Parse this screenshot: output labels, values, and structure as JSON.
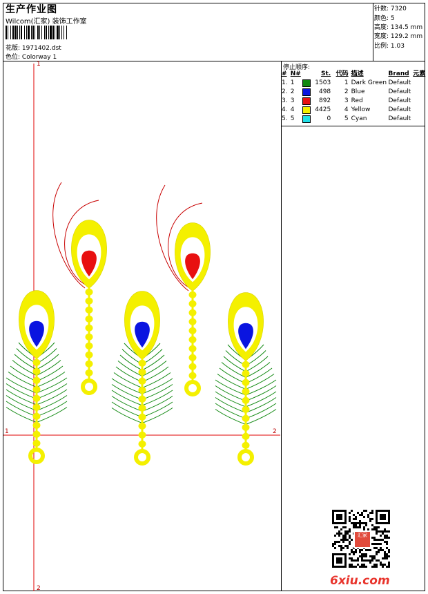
{
  "header": {
    "title": "生产作业图",
    "subtitle": "Wilcom(汇家) 装饰工作室",
    "design_label": "花版:",
    "design_value": "1971402.dst",
    "colorway_label": "色位:",
    "colorway_value": "Colorway 1"
  },
  "stats": [
    {
      "label": "针数:",
      "value": "7320"
    },
    {
      "label": "颜色:",
      "value": "5"
    },
    {
      "label": "高度:",
      "value": "134.5 mm"
    },
    {
      "label": "宽度:",
      "value": "129.2 mm"
    },
    {
      "label": "比例:",
      "value": "1.03"
    }
  ],
  "stop_sequence": {
    "title": "停止顺序:",
    "headers": [
      "#",
      "N#",
      "St.",
      "代码",
      "描述",
      "Brand",
      "元素"
    ],
    "rows": [
      {
        "num": "1.",
        "n": "1",
        "color": "#108810",
        "st": "1503",
        "code": "1",
        "desc": "Dark Green",
        "brand": "Default"
      },
      {
        "num": "2.",
        "n": "2",
        "color": "#0a14e0",
        "st": "498",
        "code": "2",
        "desc": "Blue",
        "brand": "Default"
      },
      {
        "num": "3.",
        "n": "3",
        "color": "#e81010",
        "st": "892",
        "code": "3",
        "desc": "Red",
        "brand": "Default"
      },
      {
        "num": "4.",
        "n": "4",
        "color": "#f4f000",
        "st": "4425",
        "code": "4",
        "desc": "Yellow",
        "brand": "Default"
      },
      {
        "num": "5.",
        "n": "5",
        "color": "#20e0e8",
        "st": "0",
        "code": "5",
        "desc": "Cyan",
        "brand": "Default"
      }
    ]
  },
  "axes": {
    "v_top": "1",
    "v_bottom": "2",
    "h_left": "1",
    "h_right": "2"
  },
  "watermark": "6xiu.com",
  "seal_text": "汇家",
  "palette": {
    "yellow": "#f4f000",
    "blue": "#0a14e0",
    "red": "#e81010",
    "green": "#108810",
    "axis": "#e00000",
    "thread_red": "#c80000"
  }
}
